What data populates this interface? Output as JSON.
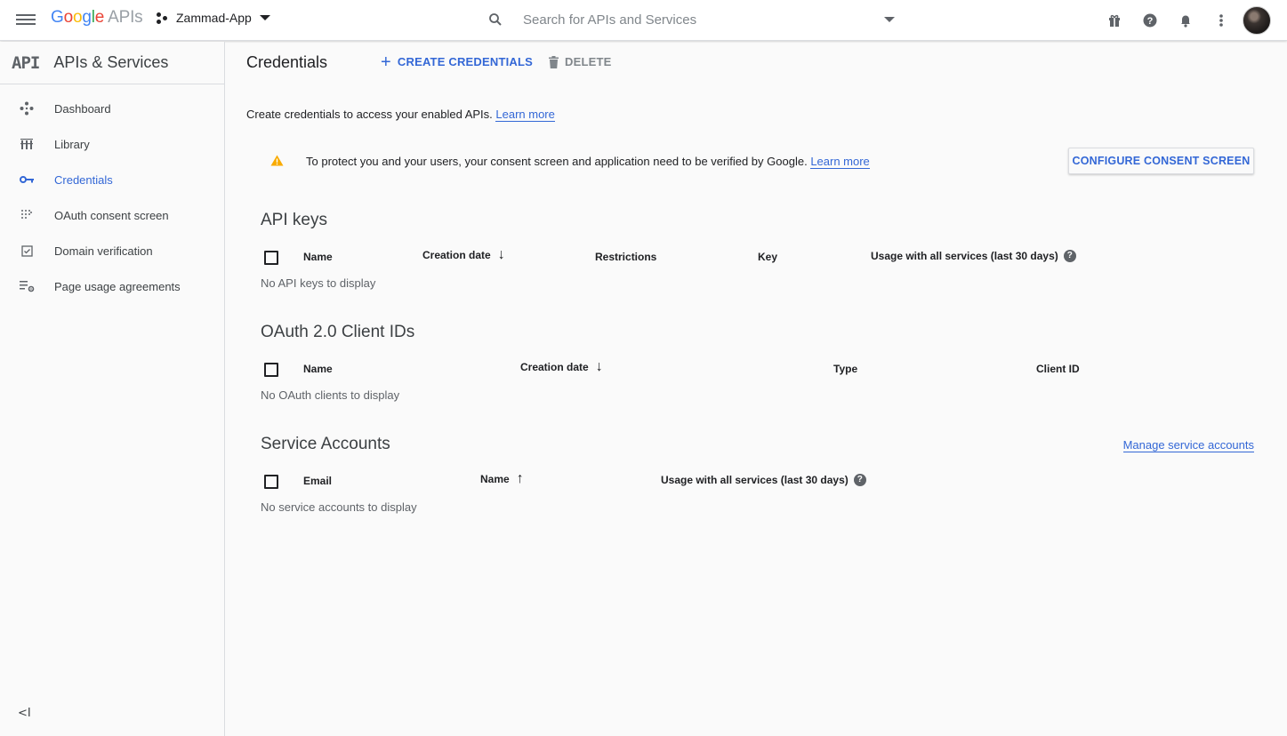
{
  "topbar": {
    "logo_google": [
      "G",
      "o",
      "o",
      "g",
      "l",
      "e"
    ],
    "logo_apis": "APIs",
    "project_name": "Zammad-App",
    "search_placeholder": "Search for APIs and Services"
  },
  "sidebar": {
    "logo": "API",
    "title": "APIs & Services",
    "items": [
      {
        "label": "Dashboard",
        "icon": "dashboard-icon"
      },
      {
        "label": "Library",
        "icon": "library-icon"
      },
      {
        "label": "Credentials",
        "icon": "key-icon",
        "active": true
      },
      {
        "label": "OAuth consent screen",
        "icon": "consent-icon"
      },
      {
        "label": "Domain verification",
        "icon": "domain-check-icon"
      },
      {
        "label": "Page usage agreements",
        "icon": "settings-list-icon"
      }
    ],
    "collapse": "<I"
  },
  "main": {
    "title": "Credentials",
    "create_label": "CREATE CREDENTIALS",
    "delete_label": "DELETE",
    "intro_text": "Create credentials to access your enabled APIs.",
    "learn_more": "Learn more",
    "notice_text": "To protect you and your users, your consent screen and application need to be verified by Google.",
    "notice_learn_more": "Learn more",
    "consent_button": "CONFIGURE CONSENT SCREEN",
    "api_keys": {
      "title": "API keys",
      "columns": [
        "Name",
        "Creation date",
        "Restrictions",
        "Key",
        "Usage with all services (last 30 days)"
      ],
      "empty": "No API keys to display"
    },
    "oauth": {
      "title": "OAuth 2.0 Client IDs",
      "columns": [
        "Name",
        "Creation date",
        "Type",
        "Client ID"
      ],
      "empty": "No OAuth clients to display"
    },
    "service_accounts": {
      "title": "Service Accounts",
      "manage_link": "Manage service accounts",
      "columns": [
        "Email",
        "Name",
        "Usage with all services (last 30 days)"
      ],
      "empty": "No service accounts to display"
    }
  },
  "colors": {
    "accent": "#3367d6",
    "warning": "#f9ab00"
  }
}
